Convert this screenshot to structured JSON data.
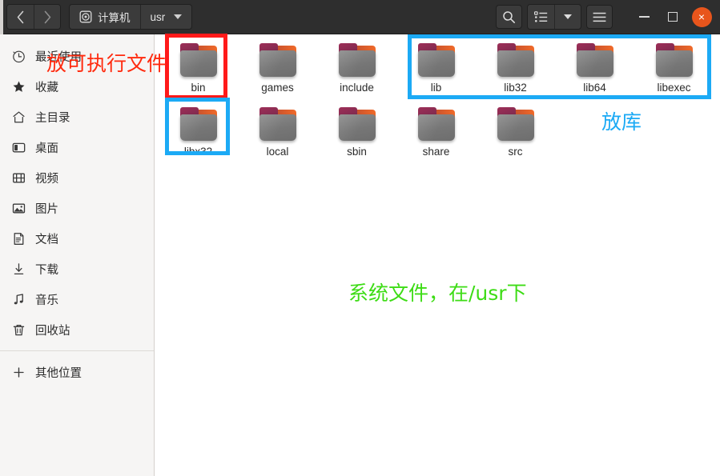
{
  "window": {
    "title_bar": {
      "nav": {
        "back_icon": "chevron-left-icon",
        "forward_icon": "chevron-right-icon"
      },
      "breadcrumbs": [
        {
          "label": "计算机",
          "icon": "disc-icon",
          "current": false
        },
        {
          "label": "usr",
          "icon": "",
          "current": true,
          "has_caret": true
        }
      ],
      "actions": [
        {
          "name": "search",
          "icon": "search-icon",
          "label": ""
        },
        {
          "name": "view-list",
          "icon": "list-view-icon",
          "label": ""
        },
        {
          "name": "view-options",
          "icon": "chevron-down-icon",
          "label": ""
        },
        {
          "name": "menu",
          "icon": "hamburger-menu-icon",
          "label": ""
        }
      ],
      "window_controls": [
        {
          "name": "minimize",
          "icon": "minimize-icon",
          "label": ""
        },
        {
          "name": "maximize",
          "icon": "maximize-icon",
          "label": ""
        },
        {
          "name": "close",
          "icon": "close-icon",
          "label": "×"
        }
      ]
    }
  },
  "sidebar": {
    "items": [
      {
        "label": "最近使用",
        "icon": "clock-icon"
      },
      {
        "label": "收藏",
        "icon": "star-icon"
      },
      {
        "label": "主目录",
        "icon": "home-icon"
      },
      {
        "label": "桌面",
        "icon": "desktop-icon"
      },
      {
        "label": "视频",
        "icon": "film-icon"
      },
      {
        "label": "图片",
        "icon": "image-icon"
      },
      {
        "label": "文档",
        "icon": "document-icon"
      },
      {
        "label": "下载",
        "icon": "download-icon"
      },
      {
        "label": "音乐",
        "icon": "music-note-icon"
      },
      {
        "label": "回收站",
        "icon": "trash-icon"
      }
    ],
    "other_locations": {
      "label": "其他位置",
      "icon": "plus-icon"
    }
  },
  "main": {
    "files": [
      {
        "name": "bin",
        "type": "folder"
      },
      {
        "name": "games",
        "type": "folder"
      },
      {
        "name": "include",
        "type": "folder"
      },
      {
        "name": "lib",
        "type": "folder"
      },
      {
        "name": "lib32",
        "type": "folder"
      },
      {
        "name": "lib64",
        "type": "folder"
      },
      {
        "name": "libexec",
        "type": "folder"
      },
      {
        "name": "libx32",
        "type": "folder"
      },
      {
        "name": "local",
        "type": "folder"
      },
      {
        "name": "sbin",
        "type": "folder"
      },
      {
        "name": "share",
        "type": "folder"
      },
      {
        "name": "src",
        "type": "folder"
      }
    ]
  },
  "annotations": {
    "red_note": {
      "text": "放可执行文件",
      "color": "#ff2a0e"
    },
    "blue_note": {
      "text": "放库",
      "color": "#1caaf5"
    },
    "green_note": {
      "text": "系统文件，在/usr下",
      "color": "#3ddc15"
    },
    "boxes": [
      {
        "name": "red-box-bin",
        "color": "#ff1a1a"
      },
      {
        "name": "blue-box-libs",
        "color": "#1caaf5"
      },
      {
        "name": "blue-box-libx32",
        "color": "#1caaf5"
      }
    ]
  }
}
